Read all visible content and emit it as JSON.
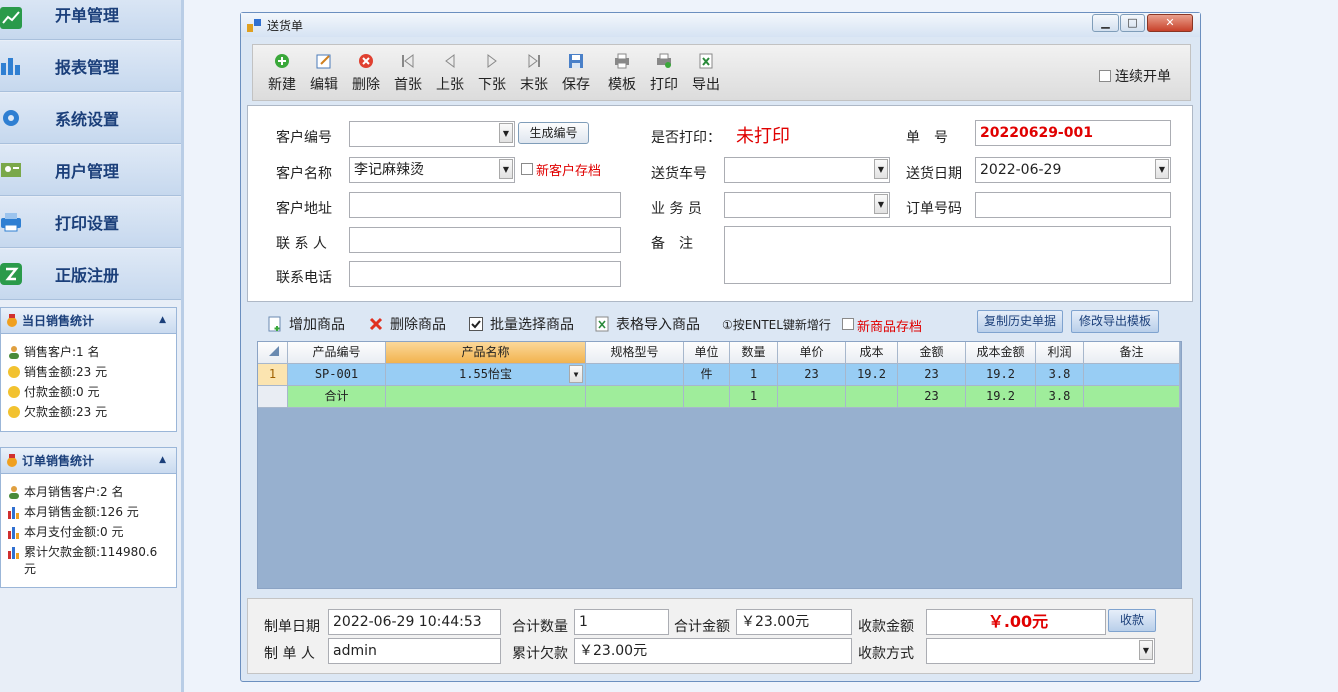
{
  "sidebar": {
    "nav": [
      "开单管理",
      "报表管理",
      "系统设置",
      "用户管理",
      "打印设置",
      "正版注册"
    ],
    "daily": {
      "title": "当日销售统计",
      "lines": [
        "销售客户:1 名",
        "销售金额:23 元",
        "付款金额:0 元",
        "欠款金额:23 元"
      ]
    },
    "order": {
      "title": "订单销售统计",
      "lines": [
        "本月销售客户:2 名",
        "本月销售金额:126 元",
        "本月支付金额:0 元",
        "累计欠款金额:114980.6",
        "元"
      ]
    }
  },
  "window": {
    "title": "送货单"
  },
  "toolbar": {
    "buttons": [
      "新建",
      "编辑",
      "删除",
      "首张",
      "上张",
      "下张",
      "末张",
      "保存",
      "模板",
      "打印",
      "导出"
    ],
    "continuous": "连续开单"
  },
  "form": {
    "customer_code_label": "客户编号",
    "customer_code": "",
    "gen_code_button": "生成编号",
    "customer_name_label": "客户名称",
    "customer_name": "李记麻辣烫",
    "new_customer_save": "新客户存档",
    "customer_addr_label": "客户地址",
    "customer_addr": "",
    "contact_label": "联 系 人",
    "contact": "",
    "phone_label": "联系电话",
    "phone": "",
    "printed_label": "是否打印：",
    "printed_value": "未打印",
    "vehicle_label": "送货车号",
    "vehicle": "",
    "salesman_label": "业 务 员",
    "salesman": "",
    "remark_label": "备　注",
    "remark": "",
    "doc_no_label": "单　号",
    "doc_no": "20220629-001",
    "delivery_date_label": "送货日期",
    "delivery_date": "2022-06-29",
    "order_no_label": "订单号码",
    "order_no": ""
  },
  "gridbar": {
    "add": "增加商品",
    "delete": "删除商品",
    "batch": "批量选择商品",
    "import": "表格导入商品",
    "enter_hint": "①按ENTEL键新增行",
    "new_product_save": "新商品存档",
    "copy_history": "复制历史单据",
    "edit_export_template": "修改导出模板"
  },
  "grid": {
    "headers": [
      "",
      "产品编号",
      "产品名称",
      "规格型号",
      "单位",
      "数量",
      "单价",
      "成本",
      "金额",
      "成本金额",
      "利润",
      "备注"
    ],
    "row1": [
      "1",
      "SP-001",
      "1.55怡宝",
      "",
      "件",
      "1",
      "23",
      "19.2",
      "23",
      "19.2",
      "3.8",
      ""
    ],
    "total": [
      "",
      "合计",
      "",
      "",
      "",
      "1",
      "",
      "",
      "23",
      "19.2",
      "3.8",
      ""
    ]
  },
  "footer": {
    "make_date_label": "制单日期",
    "make_date": "2022-06-29 10:44:53",
    "maker_label": "制 单 人",
    "maker": "admin",
    "total_qty_label": "合计数量",
    "total_qty": "1",
    "total_amount_label": "合计金额",
    "total_amount": "￥23.00元",
    "accum_debt_label": "累计欠款",
    "accum_debt": "￥23.00元",
    "receive_amount_label": "收款金额",
    "receive_amount": "￥.00元",
    "receive_button": "收款",
    "receive_method_label": "收款方式",
    "receive_method": ""
  },
  "colors": {
    "accent_red": "#e00000",
    "row_blue": "#98cdf4",
    "row_green": "#9fed9b",
    "grid_bg": "#97b0cf"
  }
}
